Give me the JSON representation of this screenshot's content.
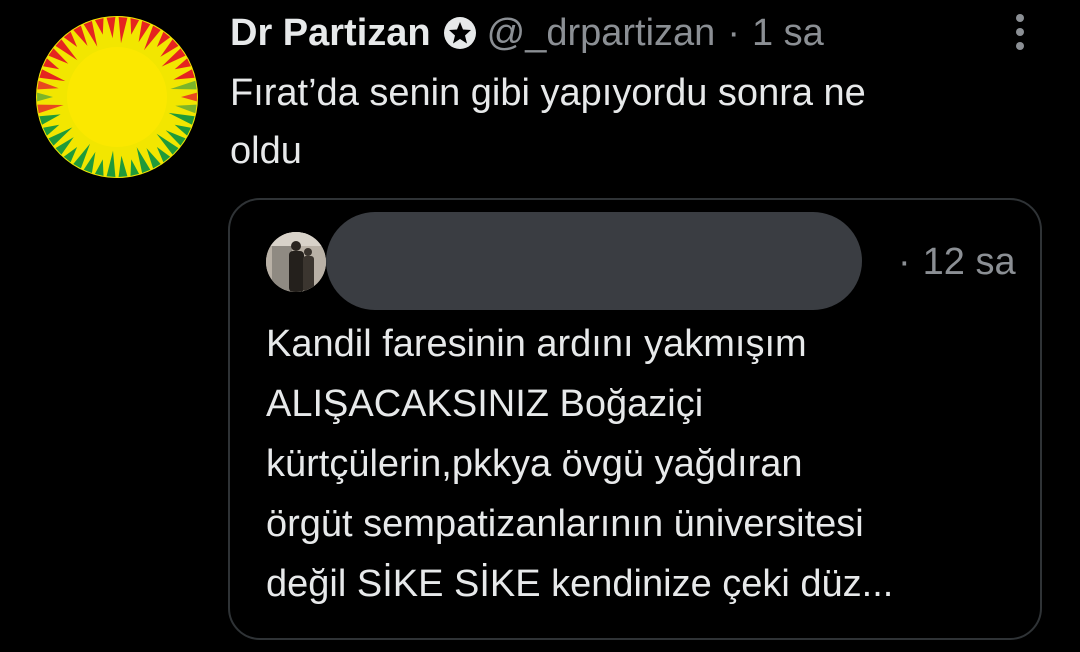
{
  "tweet": {
    "display_name": "Dr Partizan",
    "handle": "@_drpartizan",
    "separator": "·",
    "time": "1 sa",
    "text": "Fırat’da senin gibi yapıyordu sonra ne\noldu",
    "icons": {
      "avatar": "sun-avatar-icon",
      "badge": "star-badge-icon",
      "more": "more-options-icon"
    }
  },
  "quote": {
    "separator": "·",
    "time": "12 sa",
    "text": "Kandil faresinin ardını yakmışım\nALIŞACAKSINIZ Boğaziçi\nkürtçülerin,pkkya övgü yağdıran\nörgüt sempatizanlarının üniversitesi\ndeğil SİKE SİKE kendinize çeki düz...",
    "icons": {
      "avatar": "user-avatar-icon"
    }
  },
  "colors": {
    "background": "#000000",
    "text_primary": "#e7e9ea",
    "text_secondary": "#8b8f94",
    "border": "#2f3336",
    "redaction": "#3a3d42"
  }
}
